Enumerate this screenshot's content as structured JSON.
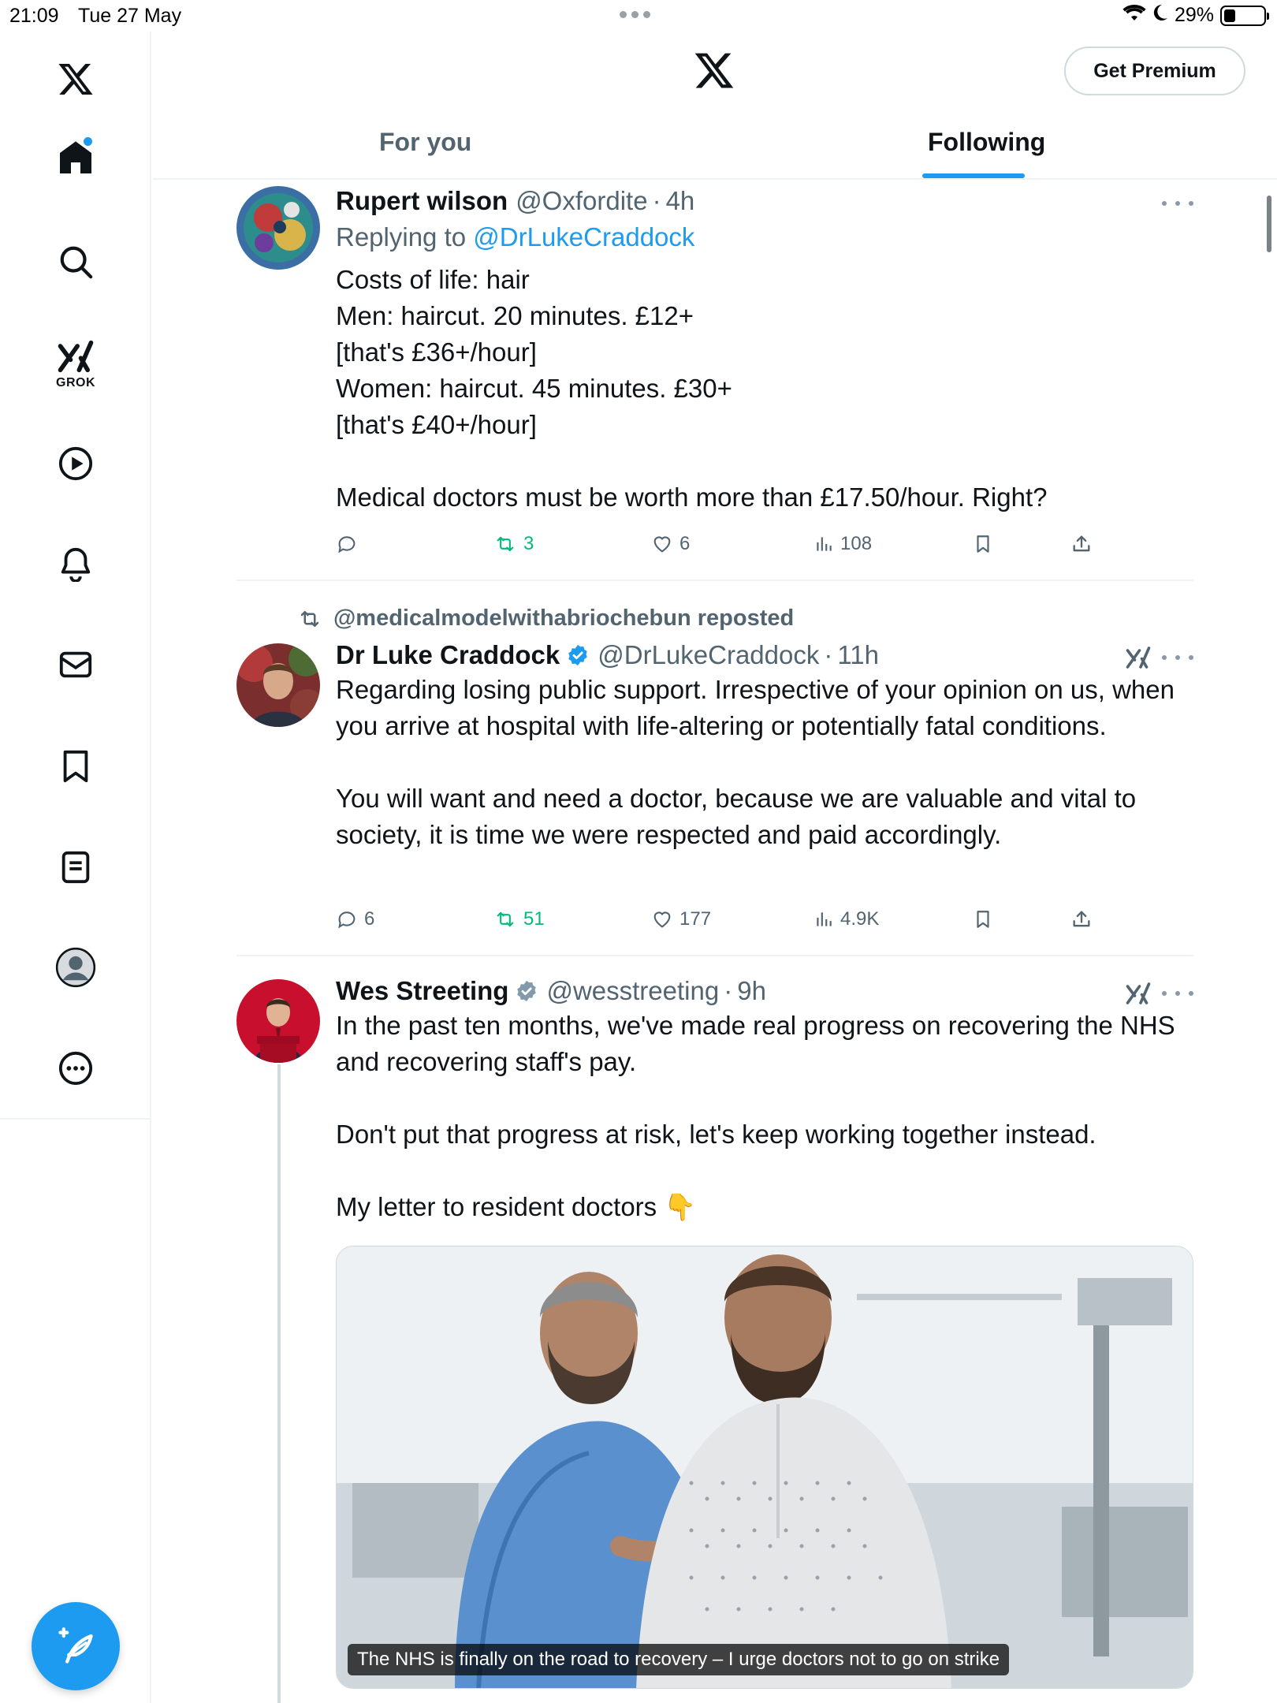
{
  "status_bar": {
    "time": "21:09",
    "date": "Tue 27 May",
    "battery": "29%",
    "battery_level": 0.29
  },
  "header": {
    "premium_label": "Get Premium",
    "tabs": [
      {
        "label": "For you",
        "active": false
      },
      {
        "label": "Following",
        "active": true
      }
    ]
  },
  "sidebar": {
    "grok_label": "GROK",
    "items": [
      "x-logo",
      "home-icon",
      "search-icon",
      "grok-icon",
      "video-icon",
      "bell-icon",
      "mail-icon",
      "bookmark-icon",
      "lists-icon",
      "profile-icon",
      "more-icon"
    ]
  },
  "colors": {
    "accent": "#1d9bf0",
    "retweet": "#00ba7c",
    "muted": "#536471"
  },
  "posts": [
    {
      "name": "Rupert wilson",
      "handle": "@Oxfordite",
      "time": "4h",
      "replying_prefix": "Replying to",
      "replying_to": "@DrLukeCraddock",
      "text": "Costs of life: hair\nMen: haircut. 20 minutes. £12+\n[that's £36+/hour]\nWomen: haircut. 45 minutes. £30+\n[that's £40+/hour]\n\nMedical doctors must be worth more than £17.50/hour. Right?",
      "replies": "",
      "reposts": "3",
      "likes": "6",
      "views": "108"
    },
    {
      "repost_by": "@medicalmodelwithabriochebun reposted",
      "name": "Dr Luke Craddock",
      "handle": "@DrLukeCraddock",
      "time": "11h",
      "text": "Regarding losing public support. Irrespective of your opinion on us, when you arrive at hospital with life-altering or potentially fatal conditions.\n\nYou will want and need a doctor, because we are valuable and vital to society, it is time we were respected and paid accordingly.",
      "replies": "6",
      "reposts": "51",
      "likes": "177",
      "views": "4.9K"
    },
    {
      "name": "Wes Streeting",
      "handle": "@wesstreeting",
      "time": "9h",
      "text": "In the past ten months, we've made real progress on recovering the NHS and recovering staff's pay.\n\nDon't put that progress at risk, let's keep working together instead.\n\nMy letter to resident doctors 👇",
      "media_caption": "The NHS is finally on the road to recovery – I urge doctors not to go on strike"
    }
  ]
}
